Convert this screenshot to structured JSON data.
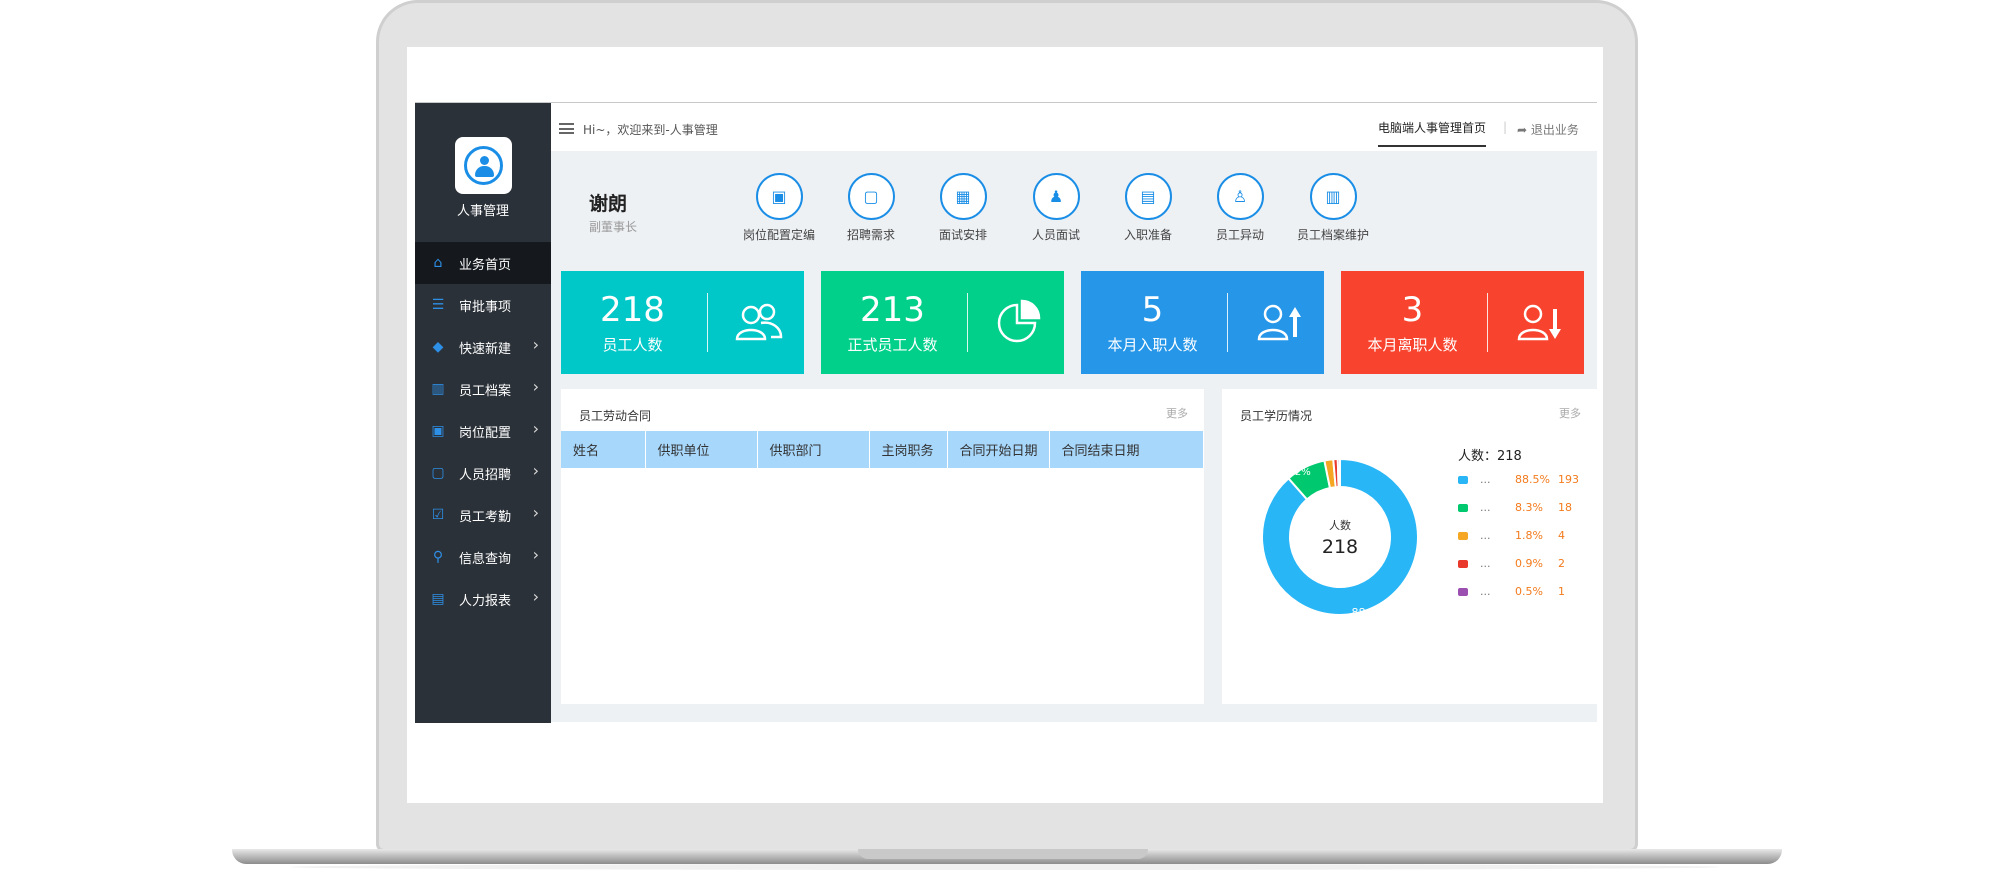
{
  "app": {
    "logo_label": "人事管理"
  },
  "topbar": {
    "greeting": "Hi~，欢迎来到-人事管理",
    "home_tab": "电脑端人事管理首页",
    "logout": "退出业务"
  },
  "user": {
    "name": "谢朗",
    "role": "副董事长"
  },
  "sidebar": {
    "items": [
      {
        "label": "业务首页",
        "icon": "home-icon",
        "active": true
      },
      {
        "label": "审批事项",
        "icon": "list-icon"
      },
      {
        "label": "快速新建",
        "icon": "layers-icon"
      },
      {
        "label": "员工档案",
        "icon": "archive-icon"
      },
      {
        "label": "岗位配置",
        "icon": "position-icon"
      },
      {
        "label": "人员招聘",
        "icon": "recruit-icon"
      },
      {
        "label": "员工考勤",
        "icon": "attendance-icon"
      },
      {
        "label": "信息查询",
        "icon": "search-icon"
      },
      {
        "label": "人力报表",
        "icon": "report-icon"
      }
    ]
  },
  "quick_actions": [
    {
      "label": "岗位配置定编",
      "icon": "id-card-icon"
    },
    {
      "label": "招聘需求",
      "icon": "person-card-icon"
    },
    {
      "label": "面试安排",
      "icon": "calendar-icon"
    },
    {
      "label": "人员面试",
      "icon": "interview-icon"
    },
    {
      "label": "入职准备",
      "icon": "badge-icon"
    },
    {
      "label": "员工异动",
      "icon": "user-change-icon"
    },
    {
      "label": "员工档案维护",
      "icon": "files-icon"
    }
  ],
  "stats": [
    {
      "value": "218",
      "label": "员工人数",
      "color": "#00c8c8",
      "icon": "group-icon"
    },
    {
      "value": "213",
      "label": "正式员工人数",
      "color": "#00d08a",
      "icon": "pie-icon"
    },
    {
      "value": "5",
      "label": "本月入职人数",
      "color": "#2596e8",
      "icon": "user-up-icon"
    },
    {
      "value": "3",
      "label": "本月离职人数",
      "color": "#f8442f",
      "icon": "user-down-icon"
    }
  ],
  "contracts": {
    "title": "员工劳动合同",
    "more": "更多",
    "columns": [
      "姓名",
      "供职单位",
      "供职部门",
      "主岗职务",
      "合同开始日期",
      "合同结束日期"
    ]
  },
  "education": {
    "title": "员工学历情况",
    "more": "更多",
    "legend_title": "人数：218",
    "center_label": "人数",
    "center_value": "218",
    "slice_labels": [
      "88.5%",
      "8.2%"
    ],
    "segments": [
      {
        "name": "...",
        "pct": "88.5%",
        "count": "193",
        "value": 193,
        "color": "#29b6f6"
      },
      {
        "name": "...",
        "pct": "8.3%",
        "count": "18",
        "value": 18,
        "color": "#00c86e"
      },
      {
        "name": "...",
        "pct": "1.8%",
        "count": "4",
        "value": 4,
        "color": "#f5a623"
      },
      {
        "name": "...",
        "pct": "0.9%",
        "count": "2",
        "value": 2,
        "color": "#e8392c"
      },
      {
        "name": "...",
        "pct": "0.5%",
        "count": "1",
        "value": 1,
        "color": "#9b4fb0"
      }
    ]
  }
}
